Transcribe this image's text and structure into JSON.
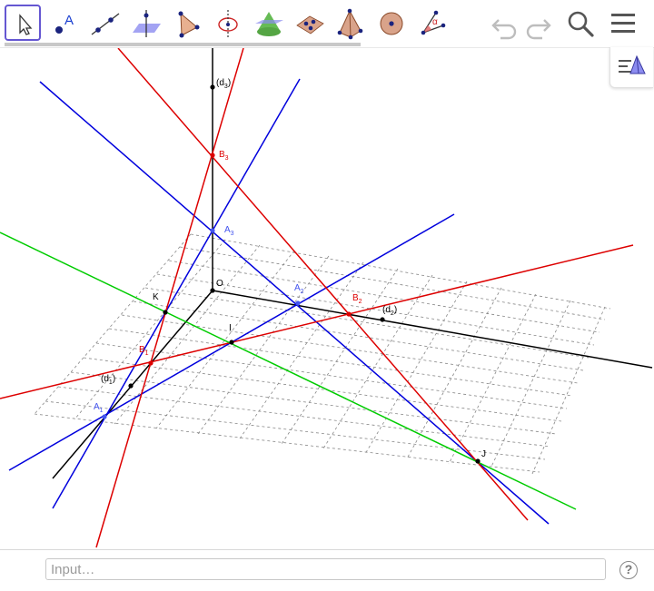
{
  "toolbar": {
    "tools": [
      {
        "id": "move",
        "icon": "move-cursor-icon",
        "selected": true
      },
      {
        "id": "point",
        "icon": "point-icon",
        "label": "A"
      },
      {
        "id": "line",
        "icon": "line-through-two-points-icon"
      },
      {
        "id": "perpendicular",
        "icon": "perpendicular-plane-icon"
      },
      {
        "id": "polygon",
        "icon": "polygon-icon"
      },
      {
        "id": "rotate",
        "icon": "rotate-around-line-icon"
      },
      {
        "id": "cone",
        "icon": "cone-icon"
      },
      {
        "id": "net",
        "icon": "net-icon"
      },
      {
        "id": "pyramid",
        "icon": "pyramid-icon"
      },
      {
        "id": "sphere",
        "icon": "sphere-icon"
      },
      {
        "id": "angle",
        "icon": "angle-icon",
        "label": "α"
      }
    ],
    "undo_icon": "undo-icon",
    "redo_icon": "redo-icon",
    "search_icon": "search-icon",
    "menu_icon": "menu-icon"
  },
  "side_toggle_icon": "algebra-view-icon",
  "colors": {
    "black_axis": "#000000",
    "blue_lines": "#0000dd",
    "red_lines": "#dd0000",
    "green_line": "#00cc00",
    "grid": "#888888",
    "accent": "#6557d2"
  },
  "canvas": {
    "labels": {
      "d3": "(d",
      "d3_sub": "3",
      "d3_close": ")",
      "d2": "(d",
      "d2_sub": "2",
      "d2_close": ")",
      "d1": "(d",
      "d1_sub": "1",
      "d1_close": ")",
      "O": "O",
      "K": "K",
      "I": "I",
      "J": "J",
      "A1": "A",
      "A1_sub": "1",
      "A2": "A",
      "A2_sub": "2",
      "A3": "A",
      "A3_sub": "3",
      "B1": "B",
      "B1_sub": "1",
      "B2": "B",
      "B2_sub": "2",
      "B3": "B",
      "B3_sub": "3"
    }
  },
  "input": {
    "placeholder": "Input…",
    "help_label": "?"
  }
}
